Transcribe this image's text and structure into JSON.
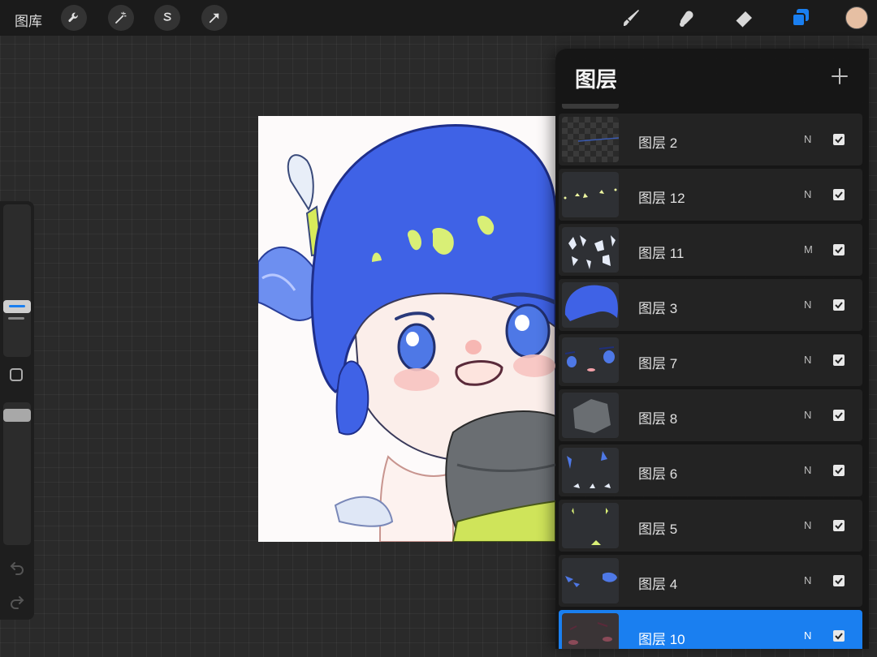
{
  "toolbar": {
    "gallery_label": "图库",
    "left_tools": [
      {
        "icon": "wrench-icon"
      },
      {
        "icon": "magic-wand-icon"
      },
      {
        "icon": "selection-s-icon"
      },
      {
        "icon": "transform-arrow-icon"
      }
    ],
    "right_tools": [
      {
        "icon": "brush-icon"
      },
      {
        "icon": "smudge-icon"
      },
      {
        "icon": "eraser-icon"
      },
      {
        "icon": "layers-icon",
        "active": true
      }
    ],
    "current_color": "#e6bfa3",
    "accent_color": "#1a7ff0"
  },
  "layers_panel": {
    "title": "图层",
    "layers": [
      {
        "name": "图层 2",
        "blend": "N",
        "visible": true,
        "selected": false
      },
      {
        "name": "图层 12",
        "blend": "N",
        "visible": true,
        "selected": false
      },
      {
        "name": "图层 11",
        "blend": "M",
        "visible": true,
        "selected": false
      },
      {
        "name": "图层 3",
        "blend": "N",
        "visible": true,
        "selected": false
      },
      {
        "name": "图层 7",
        "blend": "N",
        "visible": true,
        "selected": false
      },
      {
        "name": "图层 8",
        "blend": "N",
        "visible": true,
        "selected": false
      },
      {
        "name": "图层 6",
        "blend": "N",
        "visible": true,
        "selected": false
      },
      {
        "name": "图层 5",
        "blend": "N",
        "visible": true,
        "selected": false
      },
      {
        "name": "图层 4",
        "blend": "N",
        "visible": true,
        "selected": false
      },
      {
        "name": "图层 10",
        "blend": "N",
        "visible": true,
        "selected": true
      }
    ]
  }
}
